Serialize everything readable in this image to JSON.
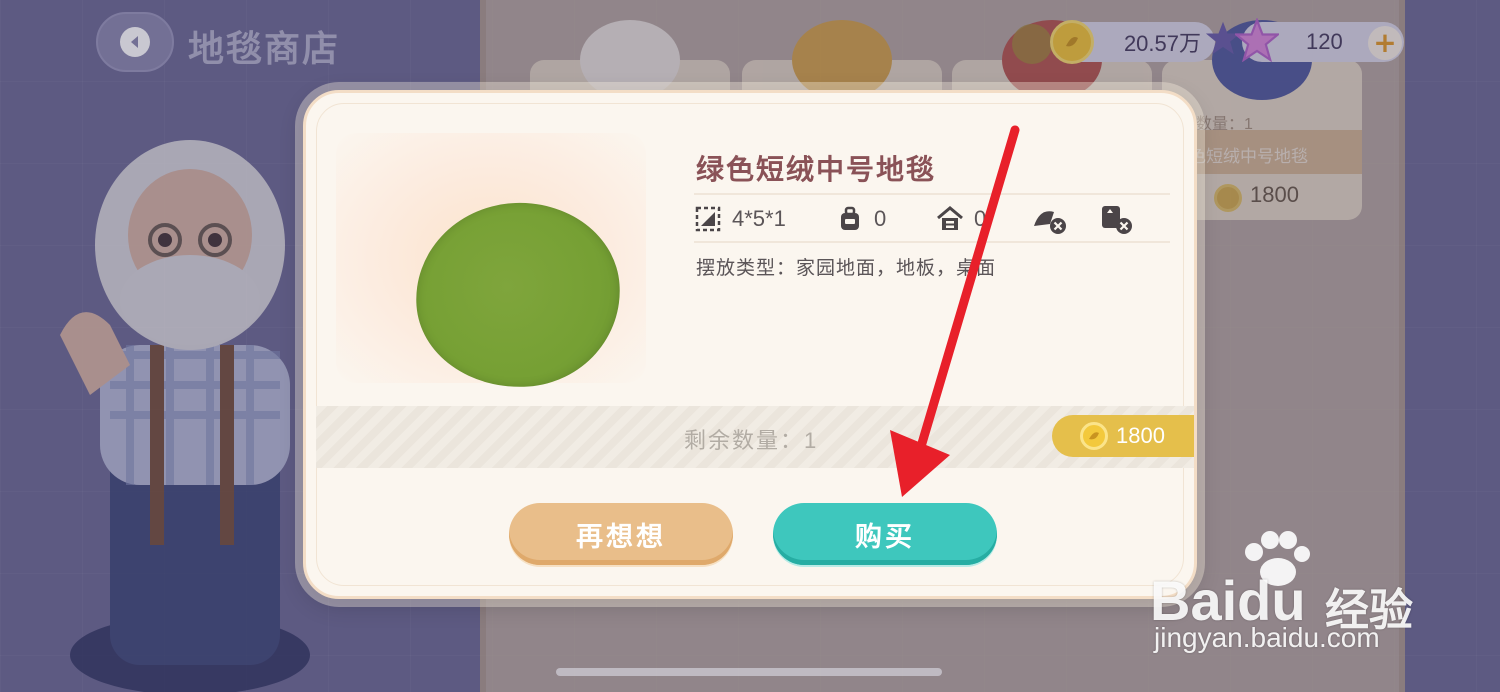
{
  "header": {
    "title": "地毯商店",
    "back_icon": "chevron-left-icon"
  },
  "wallet": {
    "coins": "20.57万",
    "stars": "120",
    "add_label": "+"
  },
  "background_card": {
    "qty_text": "余数量：1",
    "name": "蓝色短绒中号地毯",
    "price": "1800"
  },
  "dialog": {
    "item_name": "绿色短绒中号地毯",
    "stats": {
      "size": "4*5*1",
      "bag": "0",
      "home": "0"
    },
    "icons": [
      "resize-icon",
      "backpack-icon",
      "house-icon",
      "clean-disabled-icon",
      "photo-disabled-icon"
    ],
    "placement": "摆放类型：家园地面，地板，桌面",
    "stock": "剩余数量：1",
    "price": "1800",
    "rug_color": "#76a034",
    "buttons": {
      "think": "再想想",
      "buy": "购买"
    }
  },
  "watermark": {
    "brand": "Baidu",
    "brand_cn": "经验",
    "url": "jingyan.baidu.com"
  },
  "colors": {
    "buy": "#3ec7bd",
    "think": "#e9be8a",
    "price_tag": "#e5bf4b",
    "title": "#8a5257",
    "arrow": "#e8202a"
  }
}
